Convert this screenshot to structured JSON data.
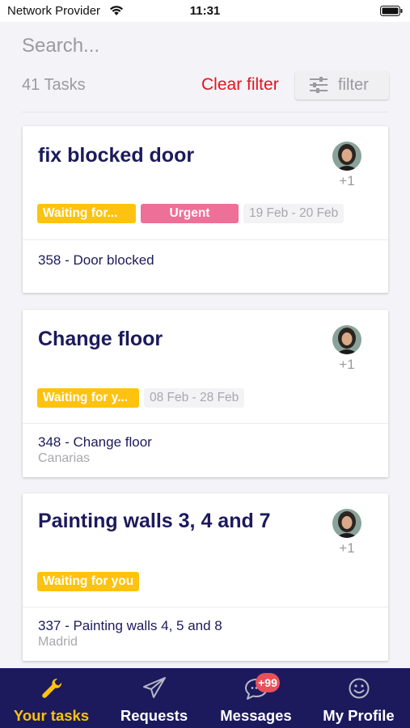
{
  "status_bar": {
    "carrier": "Network Provider",
    "time": "11:31"
  },
  "search": {
    "placeholder": "Search...",
    "value": ""
  },
  "toolbar": {
    "task_count": "41 Tasks",
    "clear_filter": "Clear filter",
    "filter_label": "filter"
  },
  "tasks": [
    {
      "title": "fix blocked door",
      "assignee_extra": "+1",
      "tags": [
        "Waiting for...",
        "Urgent"
      ],
      "date_range": "19 Feb - 20 Feb",
      "reference": "358 - Door blocked",
      "location": ""
    },
    {
      "title": "Change floor",
      "assignee_extra": "+1",
      "tags": [
        "Waiting for y..."
      ],
      "date_range": "08 Feb - 28 Feb",
      "reference": "348 - Change floor",
      "location": "Canarias"
    },
    {
      "title": "Painting walls 3, 4 and 7",
      "assignee_extra": "+1",
      "tags": [
        "Waiting for you"
      ],
      "date_range": "",
      "reference": "337 - Painting walls 4, 5 and 8",
      "location": "Madrid"
    }
  ],
  "tabbar": {
    "tabs": [
      {
        "label": "Your tasks",
        "icon": "wrench-icon",
        "active": true
      },
      {
        "label": "Requests",
        "icon": "paper-plane-icon",
        "active": false
      },
      {
        "label": "Messages",
        "icon": "chat-bubble-icon",
        "active": false
      },
      {
        "label": "My Profile",
        "icon": "smiley-icon",
        "active": false
      }
    ],
    "messages_badge": "+99"
  },
  "colors": {
    "navy": "#1c1a5c",
    "accent_yellow": "#ffc20e",
    "urgent_pink": "#ee6f97",
    "clear_red": "#e8121e",
    "badge_red": "#e8505b"
  }
}
